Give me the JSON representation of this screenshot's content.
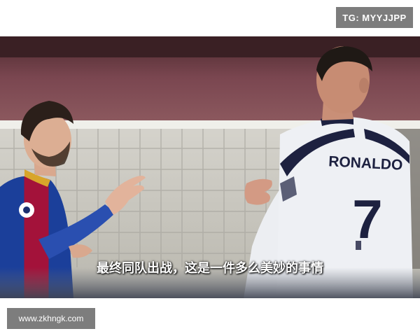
{
  "watermark": {
    "text": "TG: MYYJJPP"
  },
  "photo": {
    "subtitle": "最终同队出战，这是一件多么美妙的事情",
    "jersey_name": "RONALDO",
    "jersey_number": "7"
  },
  "footer": {
    "url_text": "www.zkhngk.com"
  },
  "colors": {
    "barca_blue": "#1b3f9a",
    "barca_red": "#a3123a",
    "juve_white": "#eef0f4",
    "stands": "#6e3a44",
    "pitch_bg": "#c8c8c2"
  }
}
